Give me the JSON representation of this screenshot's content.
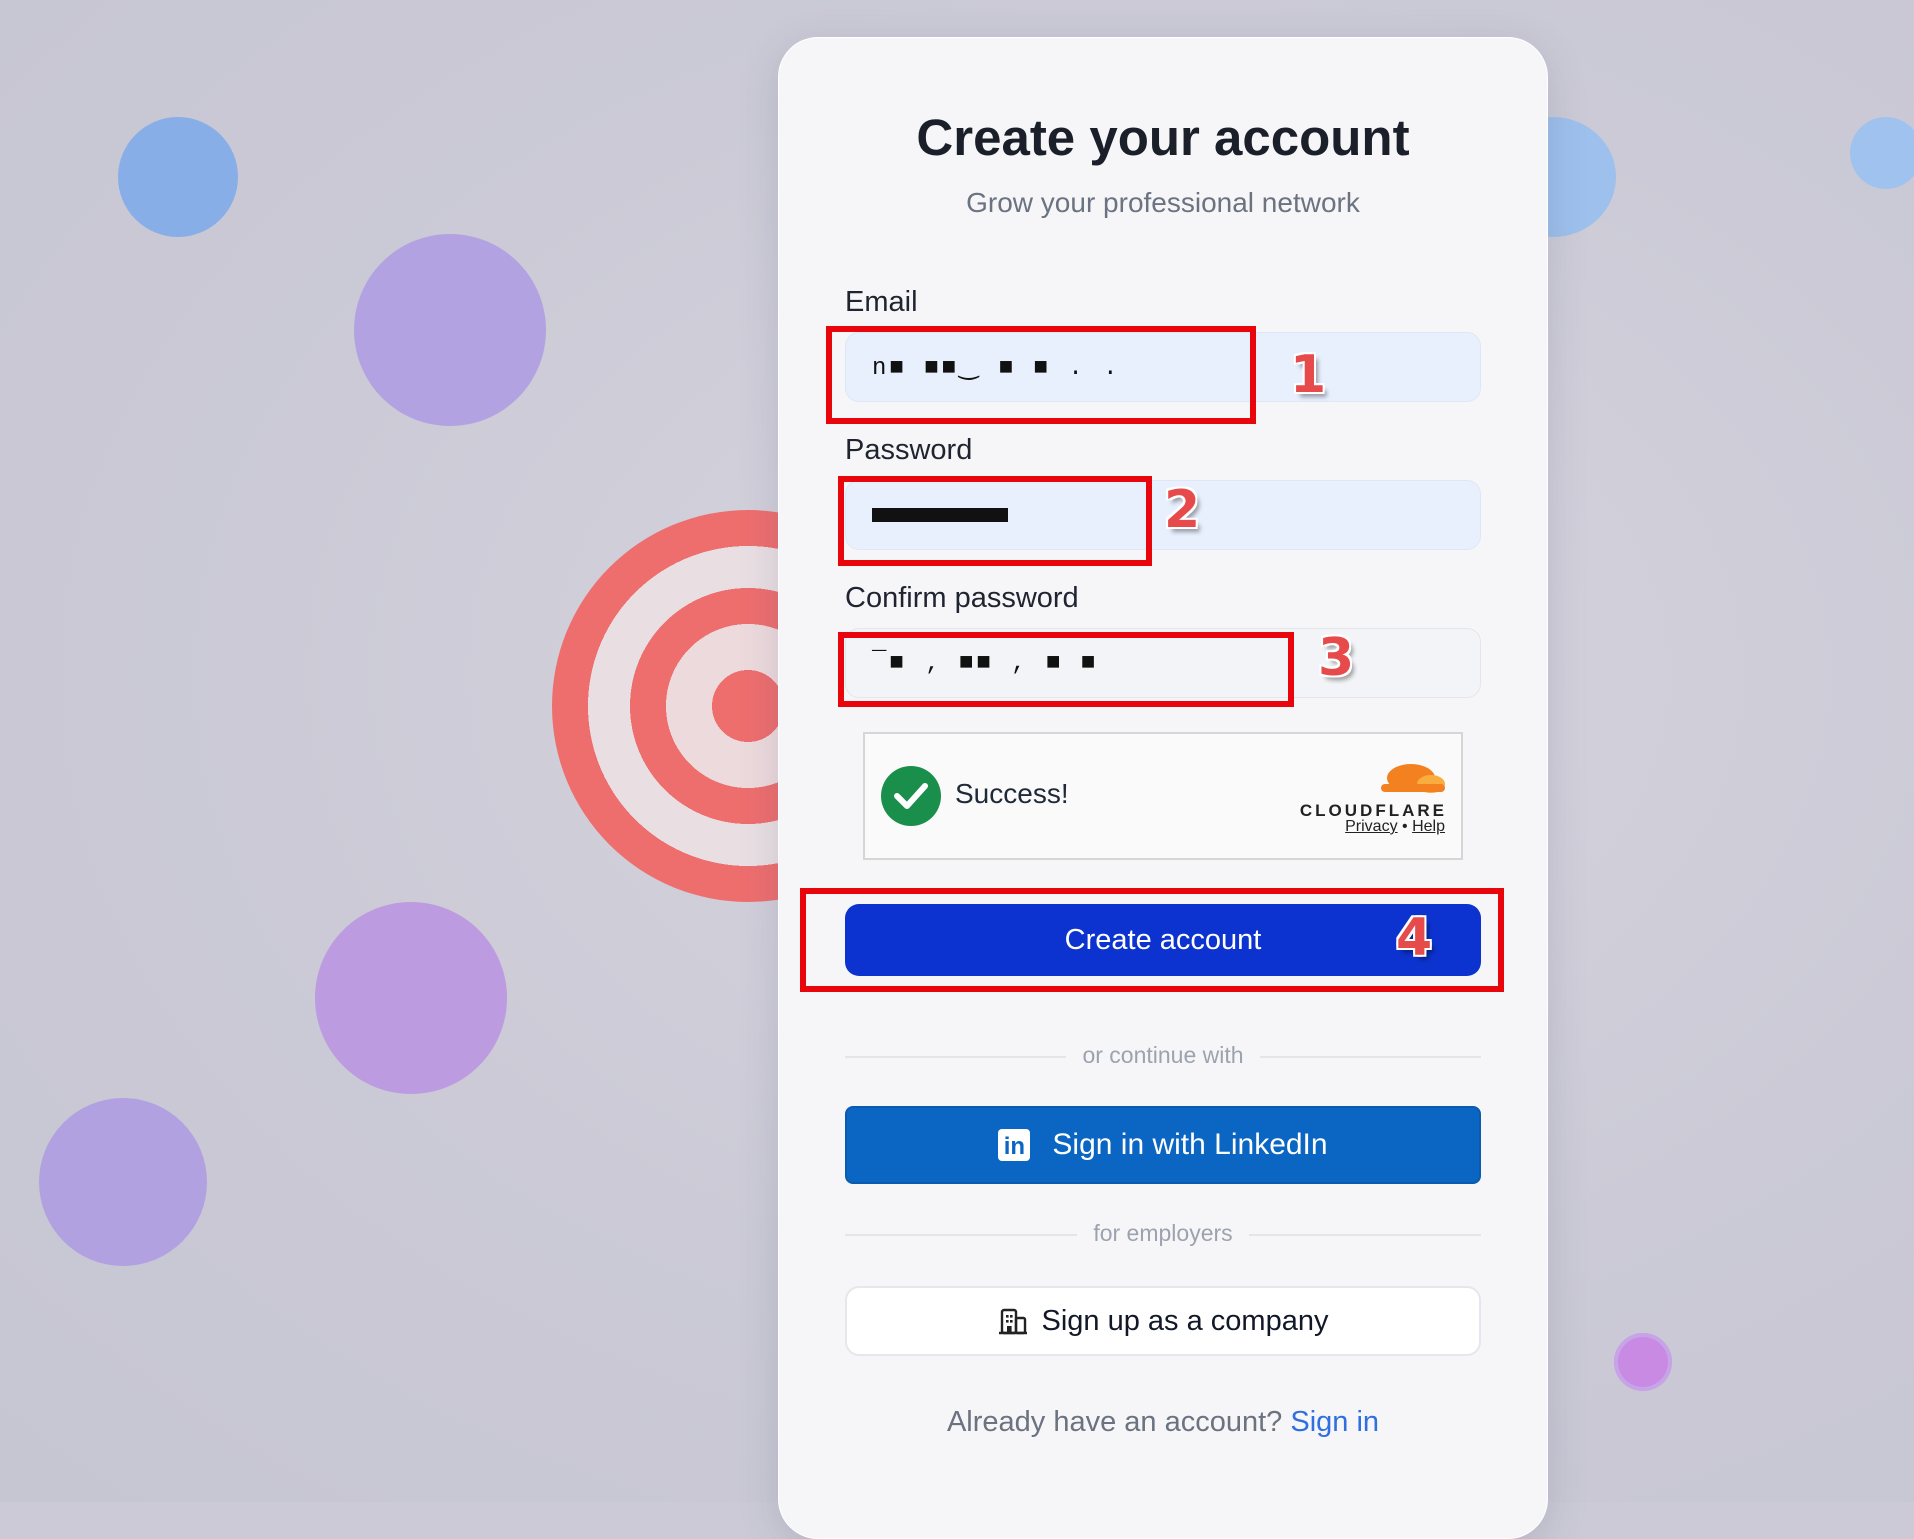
{
  "title": "Create your account",
  "subtitle": "Grow your professional network",
  "form": {
    "email_label": "Email",
    "email_value": "n■ ■■‿ ■ ■ . .",
    "password_label": "Password",
    "confirm_label": "Confirm password",
    "confirm_value": "¯■ ‚ ■■ , ■ ■"
  },
  "captcha": {
    "status": "Success!",
    "brand": "CLOUDFLARE",
    "privacy": "Privacy",
    "separator": "•",
    "help": "Help"
  },
  "annotations": [
    "1",
    "2",
    "3",
    "4"
  ],
  "primary_button": "Create account",
  "divider1": "or continue with",
  "linkedin_button": "Sign in with LinkedIn",
  "linkedin_logo": "in",
  "divider2": "for employers",
  "company_button": "Sign up as a company",
  "footer": {
    "text": "Already have an account?",
    "link": "Sign in"
  },
  "colors": {
    "primary": "#0c33d0",
    "linkedin": "#0a66c2",
    "highlight": "#e8060c",
    "link": "#2f6fe0"
  }
}
